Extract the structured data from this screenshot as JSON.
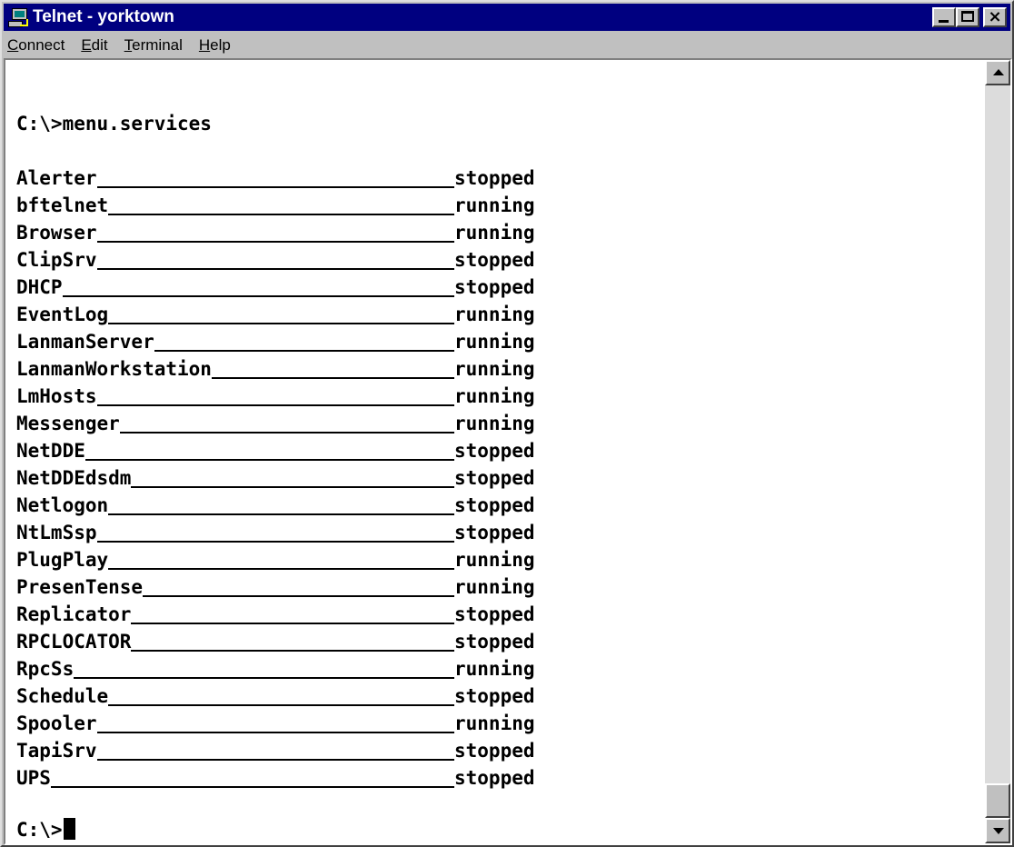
{
  "window": {
    "title": "Telnet - yorktown"
  },
  "menu": [
    {
      "label_first": "C",
      "label_rest": "onnect"
    },
    {
      "label_first": "E",
      "label_rest": "dit"
    },
    {
      "label_first": "T",
      "label_rest": "erminal"
    },
    {
      "label_first": "H",
      "label_rest": "elp"
    }
  ],
  "terminal": {
    "command_line": "C:\\>menu.services",
    "prompt": "C:\\>",
    "services": [
      {
        "name": "Alerter",
        "status": "stopped"
      },
      {
        "name": "bftelnet",
        "status": "running"
      },
      {
        "name": "Browser",
        "status": "running"
      },
      {
        "name": "ClipSrv",
        "status": "stopped"
      },
      {
        "name": "DHCP",
        "status": "stopped"
      },
      {
        "name": "EventLog",
        "status": "running"
      },
      {
        "name": "LanmanServer",
        "status": "running"
      },
      {
        "name": "LanmanWorkstation",
        "status": "running"
      },
      {
        "name": "LmHosts",
        "status": "running"
      },
      {
        "name": "Messenger",
        "status": "running"
      },
      {
        "name": "NetDDE",
        "status": "stopped"
      },
      {
        "name": "NetDDEdsdm",
        "status": "stopped"
      },
      {
        "name": "Netlogon",
        "status": "stopped"
      },
      {
        "name": "NtLmSsp",
        "status": "stopped"
      },
      {
        "name": "PlugPlay",
        "status": "running"
      },
      {
        "name": "PresenTense",
        "status": "running"
      },
      {
        "name": "Replicator",
        "status": "stopped"
      },
      {
        "name": "RPCLOCATOR",
        "status": "stopped"
      },
      {
        "name": "RpcSs",
        "status": "running"
      },
      {
        "name": "Schedule",
        "status": "stopped"
      },
      {
        "name": "Spooler",
        "status": "running"
      },
      {
        "name": "TapiSrv",
        "status": "stopped"
      },
      {
        "name": "UPS",
        "status": "stopped"
      }
    ]
  },
  "colors": {
    "titlebar": "#000080",
    "window_face": "#c0c0c0",
    "terminal_bg": "#ffffff",
    "terminal_text": "#000000"
  },
  "icons": {
    "app": "telnet-computer-icon",
    "minimize": "minimize-icon",
    "maximize": "maximize-icon",
    "close": "close-icon",
    "scroll_up": "arrow-up-icon",
    "scroll_down": "arrow-down-icon"
  }
}
